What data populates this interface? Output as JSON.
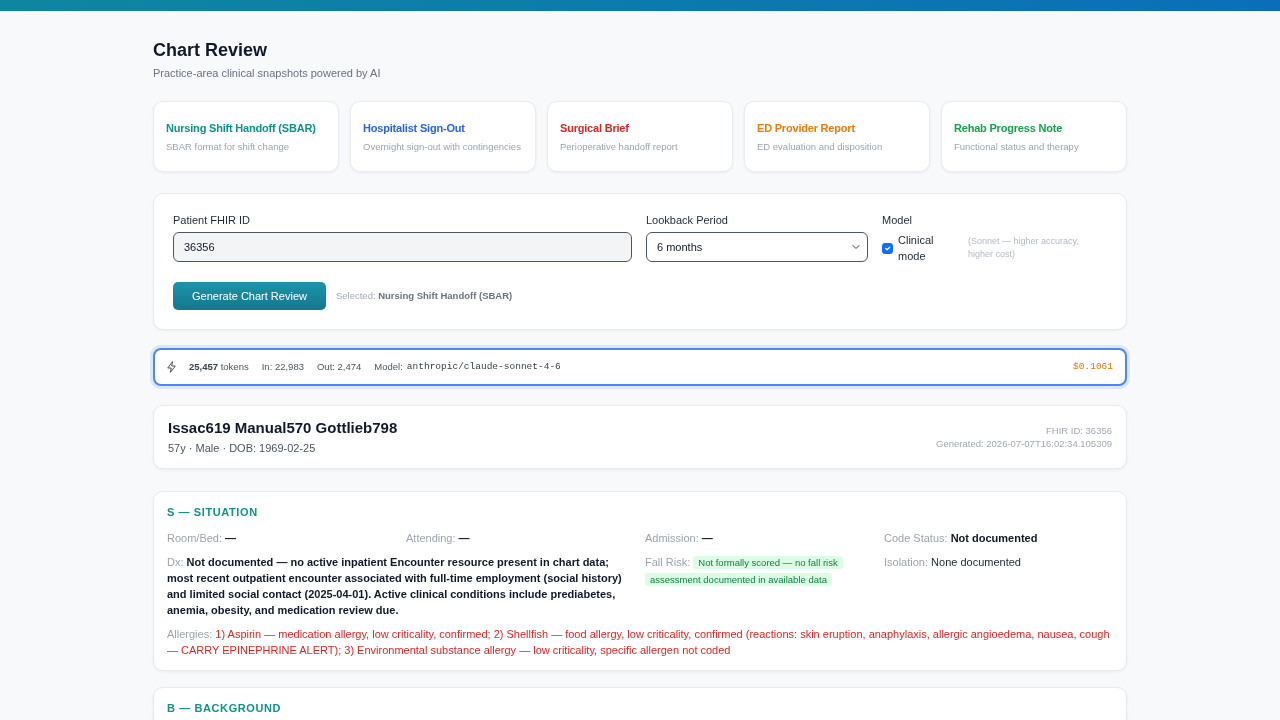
{
  "page": {
    "title": "Chart Review",
    "subtitle": "Practice-area clinical snapshots powered by AI"
  },
  "templates": [
    {
      "title": "Nursing Shift Handoff (SBAR)",
      "description": "SBAR format for shift change",
      "color": "#0d9488"
    },
    {
      "title": "Hospitalist Sign-Out",
      "description": "Overnight sign-out with contingencies",
      "color": "#2563eb"
    },
    {
      "title": "Surgical Brief",
      "description": "Perioperative handoff report",
      "color": "#dc2626"
    },
    {
      "title": "ED Provider Report",
      "description": "ED evaluation and disposition",
      "color": "#ea7c0c"
    },
    {
      "title": "Rehab Progress Note",
      "description": "Functional status and therapy",
      "color": "#16a34a"
    }
  ],
  "form": {
    "patient_id": {
      "label": "Patient FHIR ID",
      "value": "36356"
    },
    "lookback": {
      "label": "Lookback Period",
      "value": "6 months"
    },
    "model": {
      "label": "Model",
      "option": "Clinical mode",
      "checked": true,
      "hint": "(Sonnet — higher accuracy, higher cost)"
    },
    "generate_button": "Generate Chart Review",
    "selected": "Selected: **Nursing Shift Handoff (SBAR)**"
  },
  "usage": {
    "total": "**25,457** tokens",
    "input": "In: 22,983",
    "output": "Out: 2,474",
    "model_label": "Model:",
    "model": "anthropic/claude-sonnet-4-6",
    "cost": "$0.1061"
  },
  "patient": {
    "name": "Issac619 Manual570 Gottlieb798",
    "details": "57y · Male · DOB: 1969-02-25",
    "fhir_id": "FHIR ID: 36356",
    "generated": "Generated: 2026-07-07T16:02:34.105309"
  },
  "sections": [
    {
      "heading": "S — SITUATION",
      "fields": [
        {
          "label": "Room/Bed:",
          "value": "—",
          "kind": "bold"
        },
        {
          "label": "Attending:",
          "value": "—",
          "kind": "bold"
        },
        {
          "label": "Admission:",
          "value": "—",
          "kind": "bold"
        },
        {
          "label": "Code Status:",
          "value": "Not documented",
          "kind": "bold"
        },
        {
          "label": "Dx:",
          "value": "Not documented — no active inpatient Encounter resource present in chart data; most recent outpatient encounter associated with full-time employment (social history) and limited social contact (2025-04-01). Active clinical conditions include prediabetes, anemia, obesity, and medication review due.",
          "kind": "summary"
        },
        {
          "label": "Fall Risk:",
          "value": "Not formally scored — no fall risk assessment documented in available data",
          "kind": "badge"
        },
        {
          "label": "Isolation:",
          "value": "None documented",
          "kind": "plain"
        },
        {
          "label": "Allergies:",
          "value": "1) Aspirin — medication allergy, low criticality, confirmed; 2) Shellfish — food allergy, low criticality, confirmed (reactions: skin eruption, anaphylaxis, allergic angioedema, nausea, cough — CARRY EPINEPHRINE ALERT); 3) Environmental substance allergy — low criticality, specific allergen not coded",
          "kind": "alert"
        }
      ]
    },
    {
      "heading": "B — BACKGROUND"
    }
  ]
}
